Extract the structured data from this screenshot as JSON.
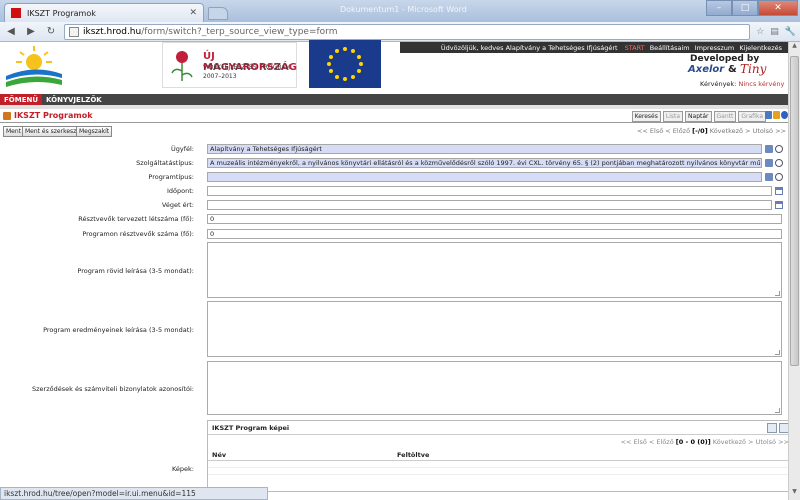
{
  "browser": {
    "tab_title": "IKSZT Programok",
    "window_title": "Dokumentum1 - Microsoft Word",
    "url_host": "ikszt.hrod.hu",
    "url_path": "/form/switch?_terp_source_view_type=form"
  },
  "header": {
    "logo2_title": "ÚJ MAGYARORSZÁG",
    "logo2_sub": "VIDÉKFEJLESZTÉSI PROGRAM",
    "logo2_years": "2007–2013",
    "welcome": "Üdvözöljük, kedves Alapítvány a Tehetséges Ifjúságért",
    "links": [
      "START",
      "Beállításaim",
      "Impresszum",
      "Kijelentkezés"
    ],
    "developed_by": "Developed by",
    "axelor": "Axelor",
    "amp": "&",
    "tiny": "Tiny",
    "requests_label": "Kérvények:",
    "requests_value": "Nincs kérvény"
  },
  "menu": {
    "items": [
      "FŐMENÜ",
      "KÖNYVJELZŐK"
    ]
  },
  "page": {
    "title": "IKSZT Programok",
    "views": [
      {
        "label": "Keresés",
        "enabled": true
      },
      {
        "label": "Lista",
        "enabled": false
      },
      {
        "label": "Naptár",
        "enabled": true
      },
      {
        "label": "Gantt",
        "enabled": false
      },
      {
        "label": "Grafika",
        "enabled": false
      }
    ],
    "actions": [
      "Ment",
      "Ment és szerkeszt",
      "Megszakít"
    ],
    "pager": {
      "prefix": "<< Első < Előző",
      "count": "[-/0]",
      "suffix": "Következő > Utolsó >>"
    }
  },
  "form": {
    "ugyfel": {
      "label": "Ügyfél:",
      "value": "Alapítvány a Tehetséges Ifjúságért"
    },
    "szolgaltatas": {
      "label": "Szolgáltatástípus:",
      "value": "A muzeális intézményekről, a nyilvános könyvtári ellátásról és a közművelődésről szóló 1997. évi CXL. törvény 65. § (2) pontjában meghatározott nyilvános könyvtár működtetése vagy"
    },
    "programtipus": {
      "label": "Programtípus:",
      "value": ""
    },
    "idopont": {
      "label": "Időpont:",
      "value": ""
    },
    "veget_ert": {
      "label": "Véget ért:",
      "value": ""
    },
    "tervezett": {
      "label": "Résztvevők tervezett létszáma (fő):",
      "value": "0"
    },
    "resztvevok": {
      "label": "Programon résztvevők száma (fő):",
      "value": "0"
    },
    "rovid_leiras": {
      "label": "Program rövid leírása (3-5 mondat):"
    },
    "eredmenyek": {
      "label": "Program eredményeinek leírása (3-5 mondat):"
    },
    "szerzodesek": {
      "label": "Szerződések és számviteli bizonylatok azonosítói:"
    },
    "kepek": {
      "label": "Képek:",
      "panel_title": "IKSZT Program képei",
      "pager_prefix": "<< Első < Előző",
      "pager_count": "[0 - 0 (0)]",
      "pager_suffix": "Következő > Utolsó >>",
      "col_name": "Név",
      "col_uploaded": "Feltöltve"
    }
  },
  "status": {
    "text": "ikszt.hrod.hu/tree/open?model=ir.ui.menu&id=115"
  },
  "colors": {
    "accent_red": "#c0202a",
    "required_field": "#d6dcf5",
    "menubar": "#444444"
  }
}
